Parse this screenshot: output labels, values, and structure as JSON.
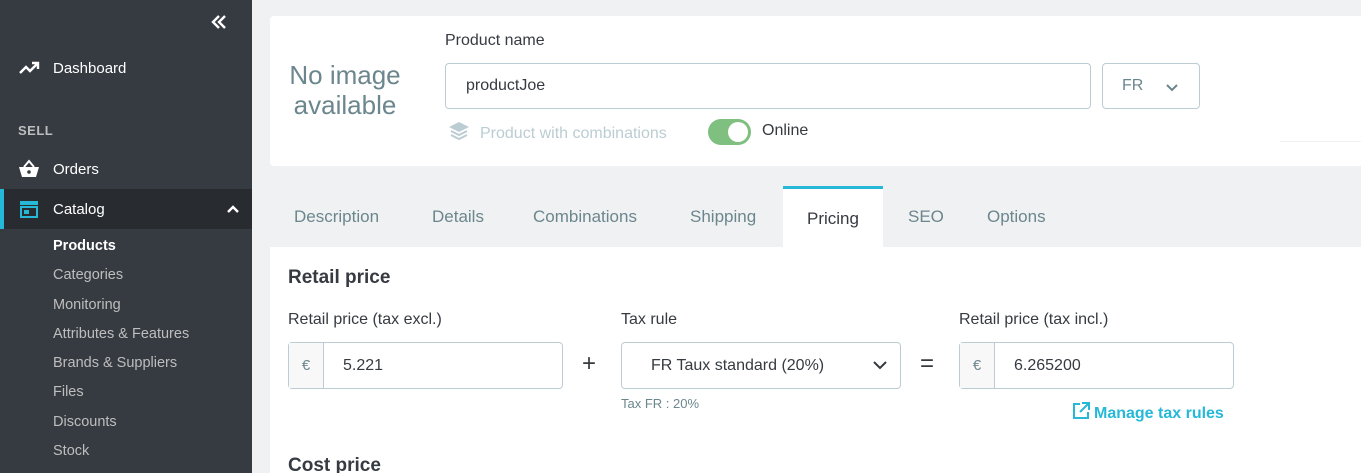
{
  "sidebar": {
    "collapse_icon": "double-chevron-left-icon",
    "dashboard": {
      "label": "Dashboard",
      "icon": "trending-up-icon"
    },
    "section_sell": "SELL",
    "orders": {
      "label": "Orders",
      "icon": "basket-icon"
    },
    "catalog": {
      "label": "Catalog",
      "icon": "store-icon",
      "expanded": true
    },
    "catalog_items": [
      "Products",
      "Categories",
      "Monitoring",
      "Attributes & Features",
      "Brands & Suppliers",
      "Files",
      "Discounts",
      "Stock"
    ],
    "active_item": "Products"
  },
  "header": {
    "no_image": "No image available",
    "product_name_label": "Product name",
    "product_name_value": "productJoe",
    "language": "FR",
    "combinations_label": "Product with combinations",
    "online_label": "Online",
    "online_enabled": true
  },
  "tabs": [
    "Description",
    "Details",
    "Combinations",
    "Shipping",
    "Pricing",
    "SEO",
    "Options"
  ],
  "active_tab": "Pricing",
  "pricing": {
    "retail_title": "Retail price",
    "excl_label": "Retail price (tax excl.)",
    "currency": "€",
    "excl_value": "5.221",
    "plus": "+",
    "tax_rule_label": "Tax rule",
    "tax_rule_value": "FR Taux standard (20%)",
    "equals": "=",
    "incl_label": "Retail price (tax incl.)",
    "incl_value": "6.265200",
    "tax_help": "Tax FR : 20%",
    "manage_tax_rules": "Manage tax rules",
    "cost_title": "Cost price"
  },
  "colors": {
    "sidebar": "#363a41",
    "accent": "#25b9d7",
    "toggle_on": "#7fbf7f",
    "background": "#eff1f2"
  }
}
